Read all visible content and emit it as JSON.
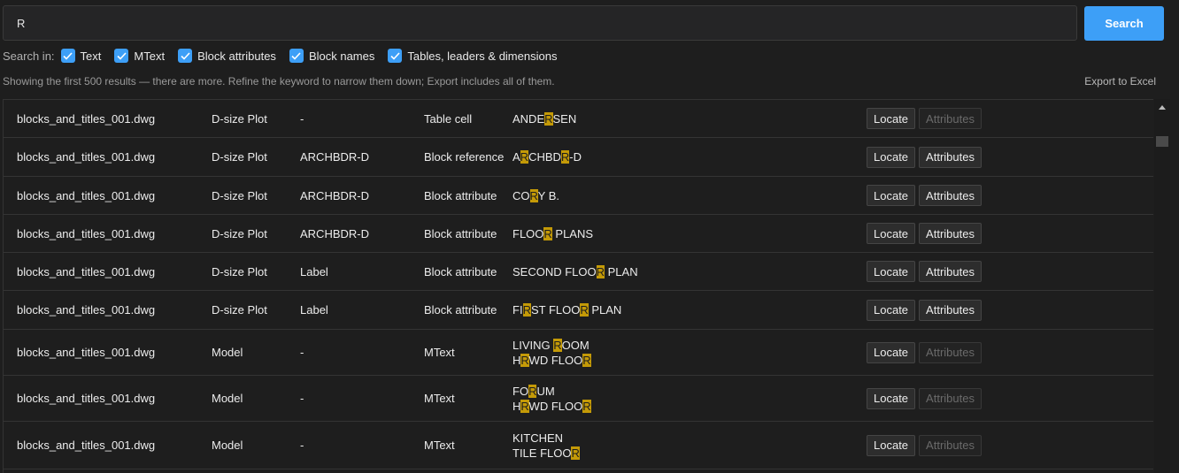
{
  "search": {
    "value": "R",
    "button_label": "Search"
  },
  "filters": {
    "label": "Search in:",
    "options": [
      {
        "label": "Text",
        "checked": true
      },
      {
        "label": "MText",
        "checked": true
      },
      {
        "label": "Block attributes",
        "checked": true
      },
      {
        "label": "Block names",
        "checked": true
      },
      {
        "label": "Tables, leaders & dimensions",
        "checked": true
      }
    ]
  },
  "notice": "Showing the first 500 results — there are more. Refine the keyword to narrow them down; Export includes all of them.",
  "export_label": "Export to Excel",
  "buttons": {
    "locate": "Locate",
    "attributes": "Attributes"
  },
  "colors": {
    "accent": "#3d9ff7",
    "highlight": "#c49a07",
    "background": "#1e1e1e"
  },
  "results": [
    {
      "file": "blocks_and_titles_001.dwg",
      "layout": "D-size Plot",
      "block": "-",
      "type": "Table cell",
      "content": [
        "ANDERSEN"
      ],
      "attributes_enabled": false
    },
    {
      "file": "blocks_and_titles_001.dwg",
      "layout": "D-size Plot",
      "block": "ARCHBDR-D",
      "type": "Block reference",
      "content": [
        "ARCHBDR-D"
      ],
      "attributes_enabled": true
    },
    {
      "file": "blocks_and_titles_001.dwg",
      "layout": "D-size Plot",
      "block": "ARCHBDR-D",
      "type": "Block attribute",
      "content": [
        "CORY B."
      ],
      "attributes_enabled": true
    },
    {
      "file": "blocks_and_titles_001.dwg",
      "layout": "D-size Plot",
      "block": "ARCHBDR-D",
      "type": "Block attribute",
      "content": [
        "FLOOR PLANS"
      ],
      "attributes_enabled": true
    },
    {
      "file": "blocks_and_titles_001.dwg",
      "layout": "D-size Plot",
      "block": "Label",
      "type": "Block attribute",
      "content": [
        "SECOND FLOOR PLAN"
      ],
      "attributes_enabled": true
    },
    {
      "file": "blocks_and_titles_001.dwg",
      "layout": "D-size Plot",
      "block": "Label",
      "type": "Block attribute",
      "content": [
        "FIRST FLOOR PLAN"
      ],
      "attributes_enabled": true
    },
    {
      "file": "blocks_and_titles_001.dwg",
      "layout": "Model",
      "block": "-",
      "type": "MText",
      "content": [
        "LIVING ROOM",
        "HRWD FLOOR"
      ],
      "attributes_enabled": false
    },
    {
      "file": "blocks_and_titles_001.dwg",
      "layout": "Model",
      "block": "-",
      "type": "MText",
      "content": [
        "FORUM",
        "HRWD FLOOR"
      ],
      "attributes_enabled": false
    },
    {
      "file": "blocks_and_titles_001.dwg",
      "layout": "Model",
      "block": "-",
      "type": "MText",
      "content": [
        "KITCHEN",
        "TILE FLOOR"
      ],
      "attributes_enabled": false
    }
  ]
}
